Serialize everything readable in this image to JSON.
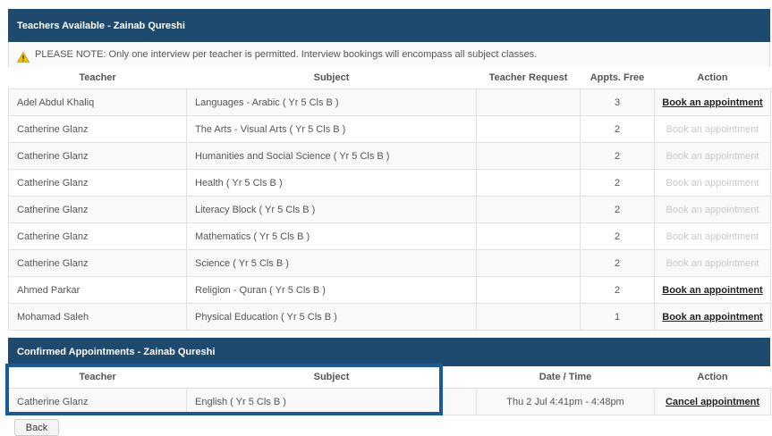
{
  "available": {
    "title": "Teachers Available - Zainab Qureshi",
    "note": "PLEASE NOTE: Only one interview per teacher is permitted. Interview bookings will encompass all subject classes.",
    "columns": {
      "teacher": "Teacher",
      "subject": "Subject",
      "request": "Teacher Request",
      "free": "Appts. Free",
      "action": "Action"
    },
    "rows": [
      {
        "teacher": "Adel Abdul Khaliq",
        "subject": "Languages - Arabic ( Yr 5 Cls B )",
        "request": "",
        "free": "3",
        "action": "Book an appointment",
        "enabled": true
      },
      {
        "teacher": "Catherine Glanz",
        "subject": "The Arts - Visual Arts ( Yr 5 Cls B )",
        "request": "",
        "free": "2",
        "action": "Book an appointment",
        "enabled": false
      },
      {
        "teacher": "Catherine Glanz",
        "subject": "Humanities and Social Science ( Yr 5 Cls B )",
        "request": "",
        "free": "2",
        "action": "Book an appointment",
        "enabled": false
      },
      {
        "teacher": "Catherine Glanz",
        "subject": "Health ( Yr 5 Cls B )",
        "request": "",
        "free": "2",
        "action": "Book an appointment",
        "enabled": false
      },
      {
        "teacher": "Catherine Glanz",
        "subject": "Literacy Block ( Yr 5 Cls B )",
        "request": "",
        "free": "2",
        "action": "Book an appointment",
        "enabled": false
      },
      {
        "teacher": "Catherine Glanz",
        "subject": "Mathematics ( Yr 5 Cls B )",
        "request": "",
        "free": "2",
        "action": "Book an appointment",
        "enabled": false
      },
      {
        "teacher": "Catherine Glanz",
        "subject": "Science ( Yr 5 Cls B )",
        "request": "",
        "free": "2",
        "action": "Book an appointment",
        "enabled": false
      },
      {
        "teacher": "Ahmed Parkar",
        "subject": "Religion - Quran ( Yr 5 Cls B )",
        "request": "",
        "free": "2",
        "action": "Book an appointment",
        "enabled": true
      },
      {
        "teacher": "Mohamad Saleh",
        "subject": "Physical Education ( Yr 5 Cls B )",
        "request": "",
        "free": "1",
        "action": "Book an appointment",
        "enabled": true
      }
    ]
  },
  "confirmed": {
    "title": "Confirmed Appointments - Zainab Qureshi",
    "columns": {
      "teacher": "Teacher",
      "subject": "Subject",
      "datetime": "Date / Time",
      "action": "Action"
    },
    "rows": [
      {
        "teacher": "Catherine Glanz",
        "subject": "English ( Yr 5 Cls B )",
        "datetime": "Thu 2 Jul 4:41pm - 4:48pm",
        "action": "Cancel appointment"
      }
    ]
  },
  "back_label": "Back",
  "colors": {
    "header_bg": "#1f4a70",
    "highlight": "#1a5a9a",
    "disabled_link": "#c8c8c8"
  },
  "icons": {
    "note": "warning-icon"
  }
}
